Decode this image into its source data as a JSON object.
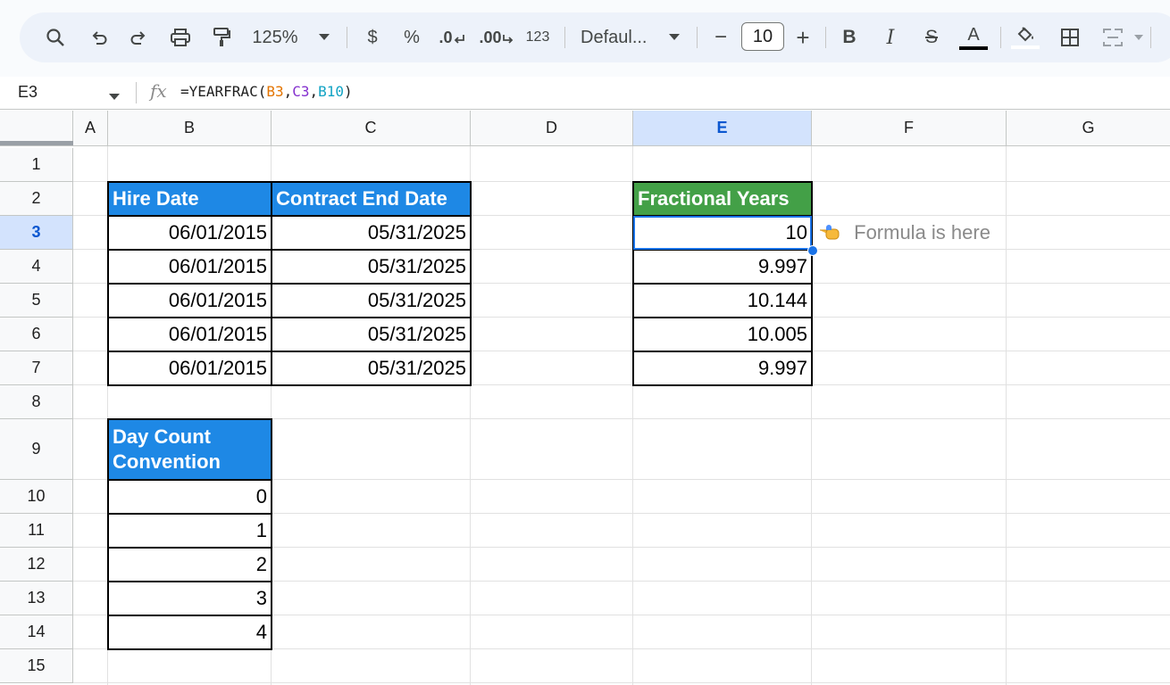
{
  "toolbar": {
    "zoom": "125%",
    "currency_label": "$",
    "percent_label": "%",
    "decrease_decimal_label": ".0",
    "increase_decimal_label": ".00",
    "number_format_label": "123",
    "font_name": "Defaul...",
    "font_size": "10",
    "minus_label": "−",
    "plus_label": "+",
    "bold_label": "B",
    "italic_label": "I",
    "strike_label": "S",
    "text_color_label": "A"
  },
  "formula_bar": {
    "name_box": "E3",
    "fx_label": "fx",
    "formula_prefix": "=YEARFRAC(",
    "ref1": "B3",
    "comma1": ",",
    "ref2": "C3",
    "comma2": ",",
    "ref3": "B10",
    "formula_suffix": ")"
  },
  "colors": {
    "ref1": "#e37400",
    "ref2": "#8430ce",
    "ref3": "#12a3c4",
    "header_blue": "#1e88e5",
    "header_green": "#43a047",
    "selection": "#1a73e8"
  },
  "columns": [
    "A",
    "B",
    "C",
    "D",
    "E",
    "F",
    "G"
  ],
  "rows": [
    "1",
    "2",
    "3",
    "4",
    "5",
    "6",
    "7",
    "8",
    "9",
    "10",
    "11",
    "12",
    "13",
    "14",
    "15"
  ],
  "table_dates": {
    "header_hire": "Hire Date",
    "header_end": "Contract End Date",
    "rows": [
      {
        "hire": "06/01/2015",
        "end": "05/31/2025"
      },
      {
        "hire": "06/01/2015",
        "end": "05/31/2025"
      },
      {
        "hire": "06/01/2015",
        "end": "05/31/2025"
      },
      {
        "hire": "06/01/2015",
        "end": "05/31/2025"
      },
      {
        "hire": "06/01/2015",
        "end": "05/31/2025"
      }
    ]
  },
  "table_years": {
    "header": "Fractional Years",
    "values": [
      "10",
      "9.997",
      "10.144",
      "10.005",
      "9.997"
    ]
  },
  "table_convention": {
    "header_line1": "Day Count",
    "header_line2": "Convention",
    "values": [
      "0",
      "1",
      "2",
      "3",
      "4"
    ]
  },
  "annotation": {
    "pointer_icon": "pointing-hand-icon",
    "text": "Formula is here"
  }
}
